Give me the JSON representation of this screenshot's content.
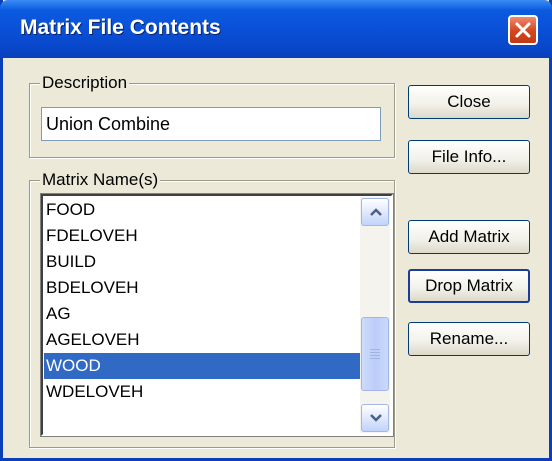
{
  "window": {
    "title": "Matrix File Contents"
  },
  "description_group": {
    "label": "Description",
    "value": "Union Combine"
  },
  "matrix_group": {
    "label": "Matrix Name(s)",
    "items": [
      "FOOD",
      "FDELOVEH",
      "BUILD",
      "BDELOVEH",
      "AG",
      "AGELOVEH",
      "WOOD",
      "WDELOVEH"
    ],
    "selected": "WOOD"
  },
  "buttons": {
    "close": "Close",
    "file_info": "File Info...",
    "add_matrix": "Add Matrix",
    "drop_matrix": "Drop Matrix",
    "rename": "Rename..."
  },
  "colors": {
    "title_bar": "#0a4fd6",
    "selection": "#316ac5",
    "dialog_face": "#ece9d8",
    "close_button": "#d3451f"
  },
  "icons": [
    "close-x-icon",
    "scroll-up-arrow-icon",
    "scroll-down-arrow-icon"
  ]
}
